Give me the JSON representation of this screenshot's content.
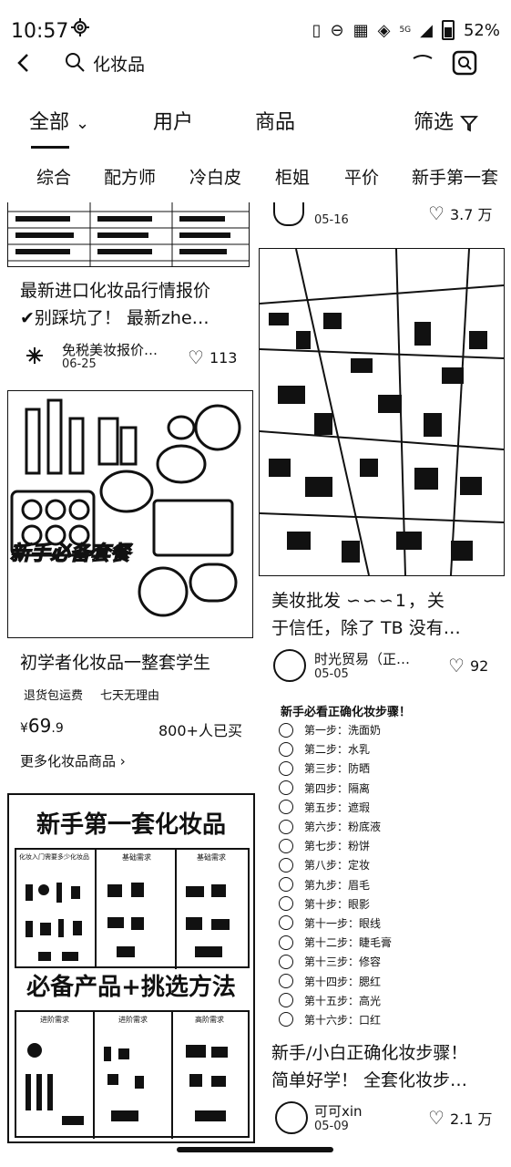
{
  "status_bar": {
    "time": "10:57",
    "battery": "52%",
    "network": "5G"
  },
  "search": {
    "query": "化妆品"
  },
  "tabs": [
    {
      "label": "全部",
      "active": true
    },
    {
      "label": "用户"
    },
    {
      "label": "商品"
    },
    {
      "label": "筛选"
    }
  ],
  "chips": [
    "综合",
    "配方师",
    "冷白皮",
    "柜姐",
    "平价",
    "新手第一套"
  ],
  "left_col": {
    "card1": {
      "title_line1": "最新进口化妆品行情报价",
      "title_line2": "✔别踩坑了！ 最新zhe…",
      "author": "免税美妆报价…",
      "date": "06-25",
      "likes": "113"
    },
    "card2": {
      "image_overlay": "新手必备套餐",
      "title": "初学者化妆品一整套学生",
      "tags": [
        "退货包运费",
        "七天无理由"
      ],
      "price_symbol": "¥",
      "price_int": "69",
      "price_dec": ".9",
      "sold": "800+人已买",
      "more_link": "更多化妆品商品"
    },
    "card3": {
      "heading1": "新手第一套化妆品",
      "heading2": "必备产品+挑选方法",
      "sections_top": [
        "化妆入门需要多少化妆品",
        "基础需求",
        "基础需求"
      ],
      "sections_bottom": [
        "进阶需求",
        "进阶需求",
        "高阶需求"
      ]
    }
  },
  "right_col": {
    "card1": {
      "date": "05-16",
      "likes": "3.7 万"
    },
    "card2": {
      "title_line1": "美妆批发",
      "title_line2": "于信任，除了 TB 没有…",
      "author": "时光贸易（正…",
      "date": "05-05",
      "likes": "92"
    },
    "card3": {
      "list_title": "新手必看正确化妆步骤！",
      "steps": [
        "第一步：洗面奶",
        "第二步：水乳",
        "第三步：防晒",
        "第四步：隔离",
        "第五步：遮瑕",
        "第六步：粉底液",
        "第七步：粉饼",
        "第八步：定妆",
        "第九步：眉毛",
        "第十步：眼影",
        "第十一步：眼线",
        "第十二步：睫毛膏",
        "第十三步：修容",
        "第十四步：腮红",
        "第十五步：高光",
        "第十六步：口红"
      ],
      "title_line1": "新手/小白正确化妆步骤！",
      "title_line2": "简单好学！ 全套化妆步…",
      "author": "可可xin",
      "date": "05-09",
      "likes": "2.1 万"
    }
  }
}
